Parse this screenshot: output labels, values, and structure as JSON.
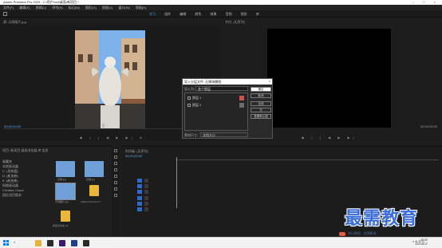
{
  "window": {
    "title": "Adobe Premiere Pro 2020 - C:\\用户\\xixi\\桌面\\新项目 *",
    "controls": [
      "–",
      "□",
      "×"
    ]
  },
  "menu": [
    "文件(F)",
    "编辑(E)",
    "剪辑(C)",
    "序列(S)",
    "标记(M)",
    "图形(G)",
    "视图(V)",
    "窗口(W)",
    "帮助(H)"
  ],
  "workspace_tabs": [
    "学习",
    "组件",
    "编辑",
    "颜色",
    "效果",
    "音频",
    "图形",
    "库"
  ],
  "workspace_active": 0,
  "source_monitor": {
    "header": "源: 示例图片.jpg",
    "timecode_left": "00;00;00;00",
    "controls": "◆ { } ◀ ▶ ▶| ⊕"
  },
  "program_monitor": {
    "header": "节目: (无序列)",
    "timecode_left": "00;00;00;00",
    "timecode_right": "00;00;00;00",
    "controls": "◆ { } ◀ ▶ ▶|"
  },
  "project_panel": {
    "tabs": "项目: 新项目  媒体浏览器  库  信息",
    "tree": [
      "收藏夹",
      "本地驱动器",
      "C: (系统盘)",
      "D: (新加卷)",
      "E: (新加卷)",
      "网络驱动器",
      "Creative Cloud",
      "团队项目版本"
    ],
    "items": [
      {
        "label": "石狮.jpg"
      },
      {
        "label": "石狮.jpg"
      },
      {
        "label": "示例图片.jpg"
      },
      {
        "label": "Adobe Premiere P..."
      },
      {
        "label": "新建文件夹 (3)"
      }
    ]
  },
  "timeline": {
    "header": "时间轴: (无序列)",
    "timecode": "00;00;00;00"
  },
  "dialog": {
    "title": "导入分层文件: 石狮海鹏图",
    "look_in_label": "导入为:",
    "look_in_value": "各个图层",
    "files": [
      {
        "name": "图层 1",
        "checked": true
      },
      {
        "name": "图层 2",
        "checked": true
      }
    ],
    "buttons": [
      "确定",
      "取消",
      "全选",
      "无",
      "重置默认值"
    ],
    "footer_label": "素材尺寸:",
    "footer_value": "文档大小"
  },
  "watermark": {
    "title": "最需教育",
    "subtitle": "学以致用 · 点亮职场"
  },
  "taskbar": {
    "search_label": "⌕",
    "tray_text": "∧  ⊕  中  ▭",
    "time": "15:02",
    "date": "2021/5/17",
    "apps": [
      {
        "color": "#e8b23a"
      },
      {
        "color": "#2a2a2a"
      },
      {
        "color": "#3a1a6a"
      },
      {
        "color": "#1f3e8c"
      },
      {
        "color": "#2a2a2a"
      }
    ]
  },
  "colors": {
    "accent": "#4b9cf0",
    "timecode": "#5fa6f5",
    "folder": "#e9b73a"
  }
}
